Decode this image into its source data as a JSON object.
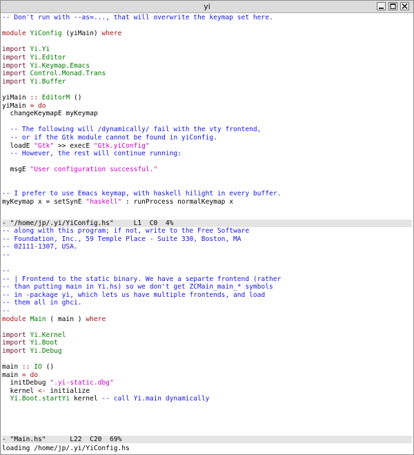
{
  "window": {
    "title": "yi"
  },
  "buffer1": {
    "lines": [
      [
        {
          "t": "-- Don't run with --as=..., that will overwrite the keymap set here.",
          "c": "comment"
        }
      ],
      [],
      [
        {
          "t": "module",
          "c": "keyword"
        },
        {
          "t": " "
        },
        {
          "t": "YiConfig",
          "c": "module"
        },
        {
          "t": " (yiMain) "
        },
        {
          "t": "where",
          "c": "keyword"
        }
      ],
      [],
      [
        {
          "t": "import",
          "c": "import"
        },
        {
          "t": " "
        },
        {
          "t": "Yi.Yi",
          "c": "module"
        }
      ],
      [
        {
          "t": "import",
          "c": "import"
        },
        {
          "t": " "
        },
        {
          "t": "Yi.Editor",
          "c": "module"
        }
      ],
      [
        {
          "t": "import",
          "c": "import"
        },
        {
          "t": " "
        },
        {
          "t": "Yi.Keymap.Emacs",
          "c": "module"
        }
      ],
      [
        {
          "t": "import",
          "c": "import"
        },
        {
          "t": " "
        },
        {
          "t": "Control.Monad.Trans",
          "c": "module"
        }
      ],
      [
        {
          "t": "import",
          "c": "import"
        },
        {
          "t": " "
        },
        {
          "t": "Yi.Buffer",
          "c": "module"
        }
      ],
      [],
      [
        {
          "t": "yiMain "
        },
        {
          "t": "::",
          "c": "operator"
        },
        {
          "t": " "
        },
        {
          "t": "EditorM",
          "c": "type"
        },
        {
          "t": " ()"
        }
      ],
      [
        {
          "t": "yiMain "
        },
        {
          "t": "=",
          "c": "operator"
        },
        {
          "t": " "
        },
        {
          "t": "do",
          "c": "keyword"
        }
      ],
      [
        {
          "t": "  changeKeymapE myKeymap"
        }
      ],
      [],
      [
        {
          "t": "  -- The following will /dynamically/ fail with the vty frontend,",
          "c": "comment"
        }
      ],
      [
        {
          "t": "  -- or if the Gtk module cannot be found in yiConfig.",
          "c": "comment"
        }
      ],
      [
        {
          "t": "  loadE "
        },
        {
          "t": "\"Gtk\"",
          "c": "string"
        },
        {
          "t": " >> execE "
        },
        {
          "t": "\"Gtk.yiConfig\"",
          "c": "string"
        }
      ],
      [
        {
          "t": "  -- However, the rest will continue running:",
          "c": "comment"
        }
      ],
      [],
      [
        {
          "t": "  msgE "
        },
        {
          "t": "\"User configuration successful.\"",
          "c": "string"
        }
      ],
      [],
      [],
      [
        {
          "t": "-- I prefer to use Emacs keymap, with haskell hilight in every buffer.",
          "c": "comment"
        }
      ],
      [
        {
          "t": "myKeymap x = setSynE "
        },
        {
          "t": "\"haskell\"",
          "c": "string"
        },
        {
          "t": " : runProcess normalKeymap x"
        }
      ]
    ]
  },
  "modeline1": {
    "text": "- \"/home/jp/.yi/YiConfig.hs\"     L1  C0  4%"
  },
  "buffer2": {
    "lines": [
      [
        {
          "t": "-- along with this program; if not, write to the Free Software",
          "c": "comment"
        }
      ],
      [
        {
          "t": "-- Foundation, Inc., 59 Temple Place - Suite 330, Boston, MA",
          "c": "comment"
        }
      ],
      [
        {
          "t": "-- 02111-1307, USA.",
          "c": "comment"
        }
      ],
      [
        {
          "t": "--",
          "c": "comment"
        }
      ],
      [],
      [
        {
          "t": "--",
          "c": "comment"
        }
      ],
      [
        {
          "t": "-- | Frontend to the static binary. We have a separte frontend (rather",
          "c": "comment"
        }
      ],
      [
        {
          "t": "-- than putting main in Yi.hs) so we don't get ZCMain_main_* symbols",
          "c": "comment"
        }
      ],
      [
        {
          "t": "-- in -package yi, which lets us have multiple frontends, and load",
          "c": "comment"
        }
      ],
      [
        {
          "t": "-- them all in ghci.",
          "c": "comment"
        }
      ],
      [
        {
          "t": "--",
          "c": "comment"
        }
      ],
      [
        {
          "t": "module",
          "c": "keyword"
        },
        {
          "t": " "
        },
        {
          "t": "Main",
          "c": "module"
        },
        {
          "t": " ( main ) "
        },
        {
          "t": "where",
          "c": "keyword"
        }
      ],
      [],
      [
        {
          "t": "import",
          "c": "import"
        },
        {
          "t": " "
        },
        {
          "t": "Yi.Kernel",
          "c": "module"
        }
      ],
      [
        {
          "t": "import",
          "c": "import"
        },
        {
          "t": " "
        },
        {
          "t": "Yi.Boot",
          "c": "module"
        }
      ],
      [
        {
          "t": "import",
          "c": "import"
        },
        {
          "t": " "
        },
        {
          "t": "Yi.Debug",
          "c": "module"
        }
      ],
      [],
      [
        {
          "t": "main "
        },
        {
          "t": "::",
          "c": "operator"
        },
        {
          "t": " "
        },
        {
          "t": "IO",
          "c": "type"
        },
        {
          "t": " ()"
        }
      ],
      [
        {
          "t": "main "
        },
        {
          "t": "=",
          "c": "operator"
        },
        {
          "t": " "
        },
        {
          "t": "do",
          "c": "keyword"
        }
      ],
      [
        {
          "t": "  initDebug "
        },
        {
          "t": "\".yi-static.dbg\"",
          "c": "string"
        }
      ],
      [
        {
          "t": "  kernel "
        },
        {
          "t": "<-",
          "c": "operator"
        },
        {
          "t": " initialize"
        }
      ],
      [
        {
          "t": "  "
        },
        {
          "t": "Yi.Boot.startYi",
          "c": "module"
        },
        {
          "t": " kernel "
        },
        {
          "t": "-- call Yi.main dynamically",
          "c": "comment"
        }
      ]
    ]
  },
  "modeline2": {
    "text": "- \"Main.hs\"      L22  C20  69%"
  },
  "minibuffer": {
    "text": "loading /home/jp/.yi/YiConfig.hs"
  }
}
